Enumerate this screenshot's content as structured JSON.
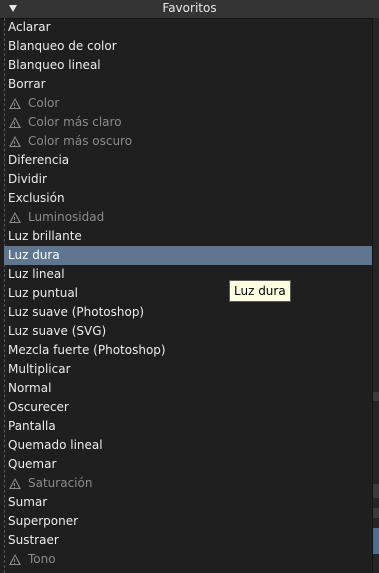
{
  "header": {
    "title": "Favoritos"
  },
  "items": [
    {
      "label": "Aclarar",
      "disabled": false
    },
    {
      "label": "Blanqueo de color",
      "disabled": false
    },
    {
      "label": "Blanqueo lineal",
      "disabled": false
    },
    {
      "label": "Borrar",
      "disabled": false
    },
    {
      "label": "Color",
      "disabled": true
    },
    {
      "label": "Color más claro",
      "disabled": true
    },
    {
      "label": "Color más oscuro",
      "disabled": true
    },
    {
      "label": "Diferencia",
      "disabled": false
    },
    {
      "label": "Dividir",
      "disabled": false
    },
    {
      "label": "Exclusión",
      "disabled": false
    },
    {
      "label": "Luminosidad",
      "disabled": true
    },
    {
      "label": "Luz brillante",
      "disabled": false
    },
    {
      "label": "Luz dura",
      "disabled": false,
      "selected": true
    },
    {
      "label": "Luz lineal",
      "disabled": false
    },
    {
      "label": "Luz puntual",
      "disabled": false
    },
    {
      "label": "Luz suave (Photoshop)",
      "disabled": false
    },
    {
      "label": "Luz suave (SVG)",
      "disabled": false
    },
    {
      "label": "Mezcla fuerte (Photoshop)",
      "disabled": false
    },
    {
      "label": "Multiplicar",
      "disabled": false
    },
    {
      "label": "Normal",
      "disabled": false
    },
    {
      "label": "Oscurecer",
      "disabled": false
    },
    {
      "label": "Pantalla",
      "disabled": false
    },
    {
      "label": "Quemado lineal",
      "disabled": false
    },
    {
      "label": "Quemar",
      "disabled": false
    },
    {
      "label": "Saturación",
      "disabled": true
    },
    {
      "label": "Sumar",
      "disabled": false
    },
    {
      "label": "Superponer",
      "disabled": false
    },
    {
      "label": "Sustraer",
      "disabled": false
    },
    {
      "label": "Tono",
      "disabled": true
    }
  ],
  "tooltip": {
    "text": "Luz dura"
  },
  "icons": {
    "header_toggle": "triangle-down-icon",
    "unavailable": "warning-icon"
  },
  "colors": {
    "selection": "#5e7690",
    "tooltip_bg": "#ffffe1",
    "disabled_text": "#8b8b8b"
  }
}
